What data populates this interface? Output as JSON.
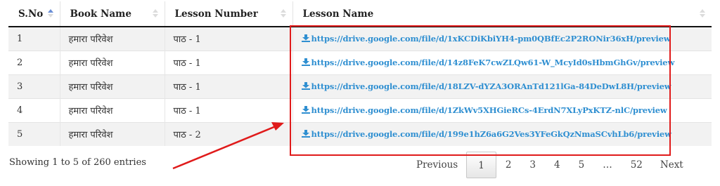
{
  "table": {
    "headers": [
      "S.No",
      "Book Name",
      "Lesson Number",
      "Lesson Name"
    ],
    "rows": [
      {
        "sno": "1",
        "book": "हमारा परिवेश",
        "lesson": "पाठ - 1",
        "link": "https://drive.google.com/file/d/1xKCDiKbiYH4-pm0QBfEc2P2RONir36xH/preview"
      },
      {
        "sno": "2",
        "book": "हमारा परिवेश",
        "lesson": "पाठ - 1",
        "link": "https://drive.google.com/file/d/14z8FeK7cwZLQw61-W_McyId0sHbmGhGv/preview"
      },
      {
        "sno": "3",
        "book": "हमारा परिवेश",
        "lesson": "पाठ - 1",
        "link": "https://drive.google.com/file/d/18LZV-dYZA3ORAnTd121lGa-84DeDwL8H/preview"
      },
      {
        "sno": "4",
        "book": "हमारा परिवेश",
        "lesson": "पाठ - 1",
        "link": "https://drive.google.com/file/d/1ZkWv5XHGieRCs-4ErdN7XLyPxKTZ-nlC/preview"
      },
      {
        "sno": "5",
        "book": "हमारा परिवेश",
        "lesson": "पाठ - 2",
        "link": "https://drive.google.com/file/d/199e1hZ6a6G2Ves3YFeGkQzNmaSCvhLb6/preview"
      }
    ]
  },
  "info": "Showing 1 to 5 of 260 entries",
  "pagination": {
    "previous": "Previous",
    "pages": [
      "1",
      "2",
      "3",
      "4",
      "5",
      "…",
      "52"
    ],
    "current": "1",
    "next": "Next"
  },
  "colors": {
    "link": "#2f8fd1",
    "annotation": "#e01b1b",
    "sort_active": "#6a8fd6"
  },
  "icons": {
    "download": "download-icon",
    "sort": "sort-icon"
  }
}
